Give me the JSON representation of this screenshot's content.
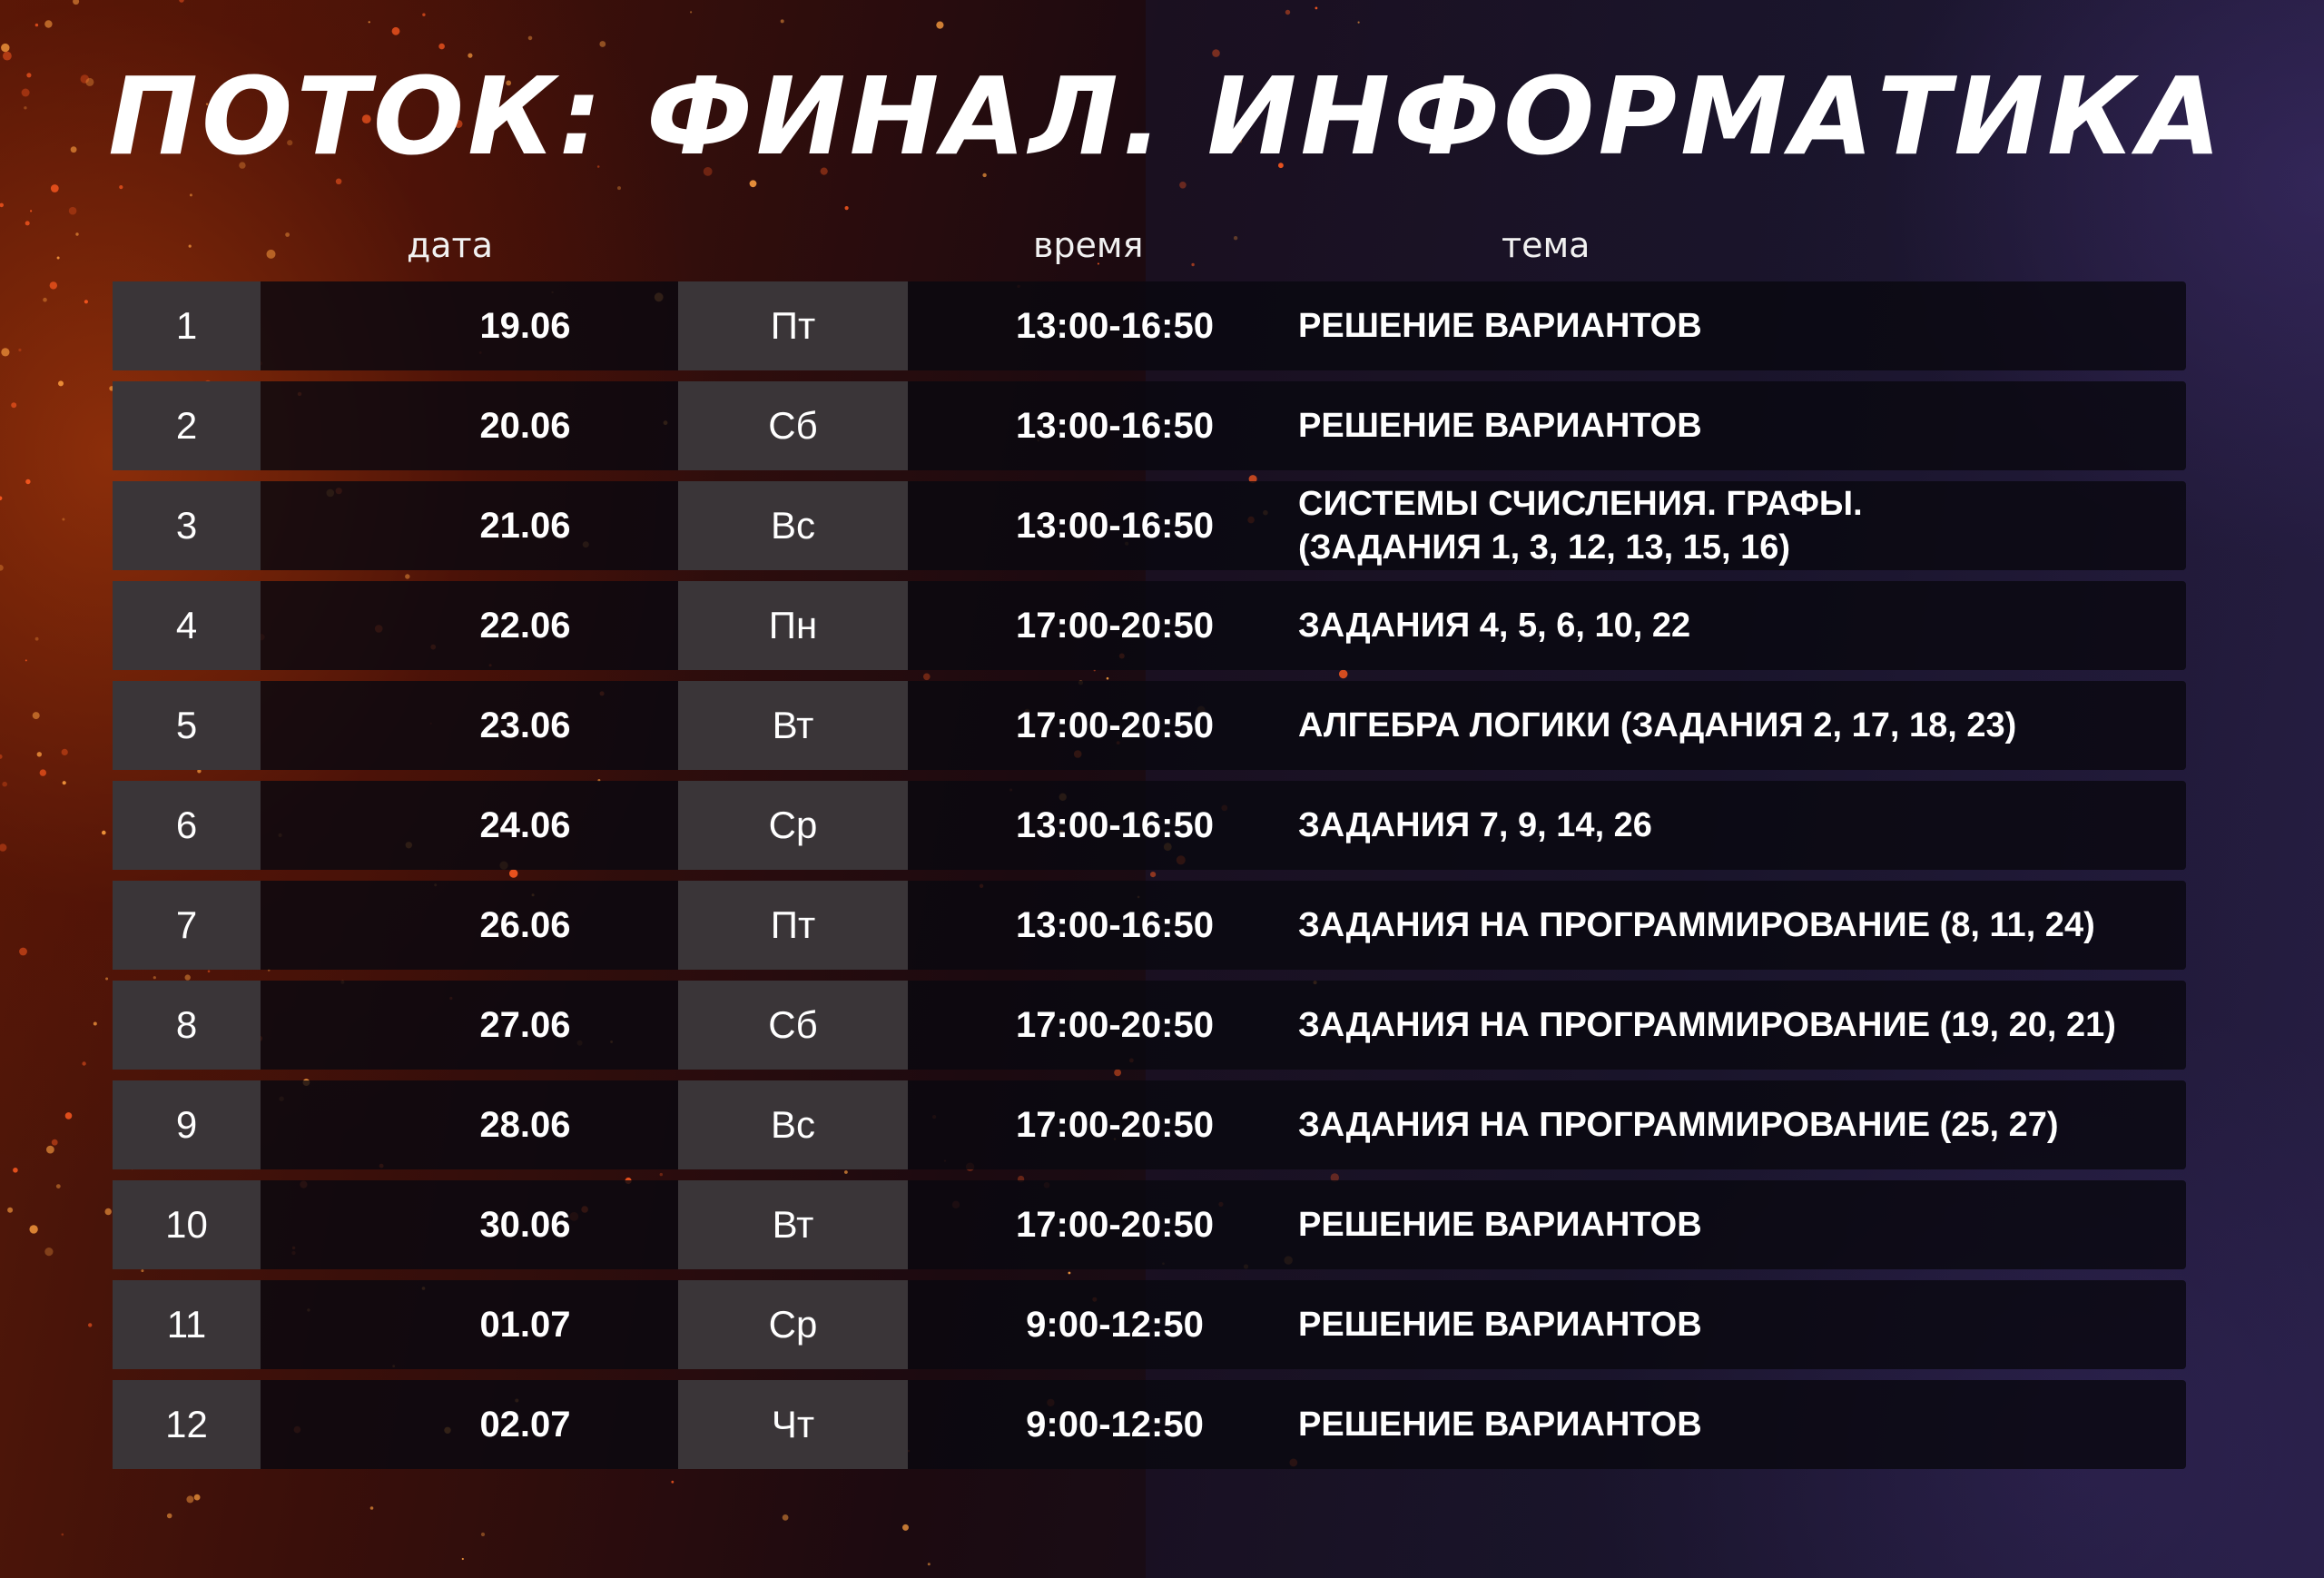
{
  "title": "ПОТОК: ФИНАЛ. ИНФОРМАТИКА",
  "headers": {
    "date": "дата",
    "time": "время",
    "topic": "тема"
  },
  "rows": [
    {
      "num": "1",
      "date": "19.06",
      "day": "Пт",
      "time": "13:00-16:50",
      "topic": [
        "РЕШЕНИЕ ВАРИАНТОВ"
      ]
    },
    {
      "num": "2",
      "date": "20.06",
      "day": "Сб",
      "time": "13:00-16:50",
      "topic": [
        "РЕШЕНИЕ ВАРИАНТОВ"
      ]
    },
    {
      "num": "3",
      "date": "21.06",
      "day": "Вс",
      "time": "13:00-16:50",
      "topic": [
        "СИСТЕМЫ СЧИСЛЕНИЯ. ГРАФЫ.",
        "(ЗАДАНИЯ 1, 3, 12, 13, 15, 16)"
      ]
    },
    {
      "num": "4",
      "date": "22.06",
      "day": "Пн",
      "time": "17:00-20:50",
      "topic": [
        "ЗАДАНИЯ 4, 5, 6, 10, 22"
      ]
    },
    {
      "num": "5",
      "date": "23.06",
      "day": "Вт",
      "time": "17:00-20:50",
      "topic": [
        "АЛГЕБРА ЛОГИКИ (ЗАДАНИЯ 2, 17, 18, 23)"
      ]
    },
    {
      "num": "6",
      "date": "24.06",
      "day": "Ср",
      "time": "13:00-16:50",
      "topic": [
        "ЗАДАНИЯ 7, 9, 14, 26"
      ]
    },
    {
      "num": "7",
      "date": "26.06",
      "day": "Пт",
      "time": "13:00-16:50",
      "topic": [
        "ЗАДАНИЯ НА ПРОГРАММИРОВАНИЕ (8, 11, 24)"
      ]
    },
    {
      "num": "8",
      "date": "27.06",
      "day": "Сб",
      "time": "17:00-20:50",
      "topic": [
        "ЗАДАНИЯ НА ПРОГРАММИРОВАНИЕ (19, 20, 21)"
      ]
    },
    {
      "num": "9",
      "date": "28.06",
      "day": "Вс",
      "time": "17:00-20:50",
      "topic": [
        "ЗАДАНИЯ НА ПРОГРАММИРОВАНИЕ (25, 27)"
      ]
    },
    {
      "num": "10",
      "date": "30.06",
      "day": "Вт",
      "time": "17:00-20:50",
      "topic": [
        "РЕШЕНИЕ ВАРИАНТОВ"
      ]
    },
    {
      "num": "11",
      "date": "01.07",
      "day": "Ср",
      "time": "9:00-12:50",
      "topic": [
        "РЕШЕНИЕ ВАРИАНТОВ"
      ]
    },
    {
      "num": "12",
      "date": "02.07",
      "day": "Чт",
      "time": "9:00-12:50",
      "topic": [
        "РЕШЕНИЕ ВАРИАНТОВ"
      ]
    }
  ]
}
